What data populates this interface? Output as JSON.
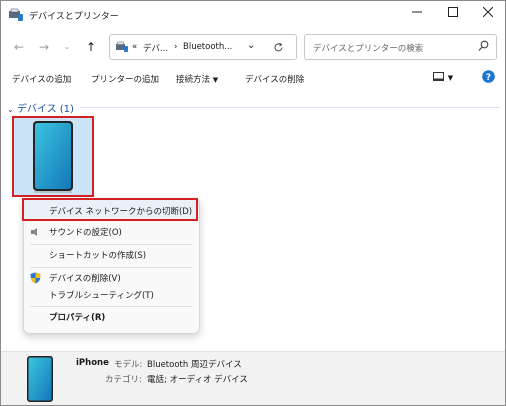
{
  "window": {
    "title": "デバイスとプリンター"
  },
  "address": {
    "overflow": "«",
    "crumb1": "デバ...",
    "sep": "›",
    "crumb2": "Bluetooth..."
  },
  "search": {
    "placeholder": "デバイスとプリンターの検索"
  },
  "toolbar": {
    "add_device": "デバイスの追加",
    "add_printer": "プリンターの追加",
    "connect_via": "接続方法",
    "remove_device": "デバイスの削除"
  },
  "group": {
    "label": "デバイス (1)"
  },
  "context_menu": {
    "items": [
      "デバイス ネットワークからの切断(D)",
      "サウンドの設定(O)",
      "ショートカットの作成(S)",
      "デバイスの削除(V)",
      "トラブルシューティング(T)",
      "プロパティ(R)"
    ]
  },
  "details": {
    "name": "iPhone",
    "model_label": "モデル:",
    "model_value": "Bluetooth 周辺デバイス",
    "category_label": "カテゴリ:",
    "category_value": "電話; オーディオ デバイス"
  },
  "colors": {
    "accent": "#1a4fa0",
    "highlight": "#d42025",
    "help": "#1976d2"
  }
}
